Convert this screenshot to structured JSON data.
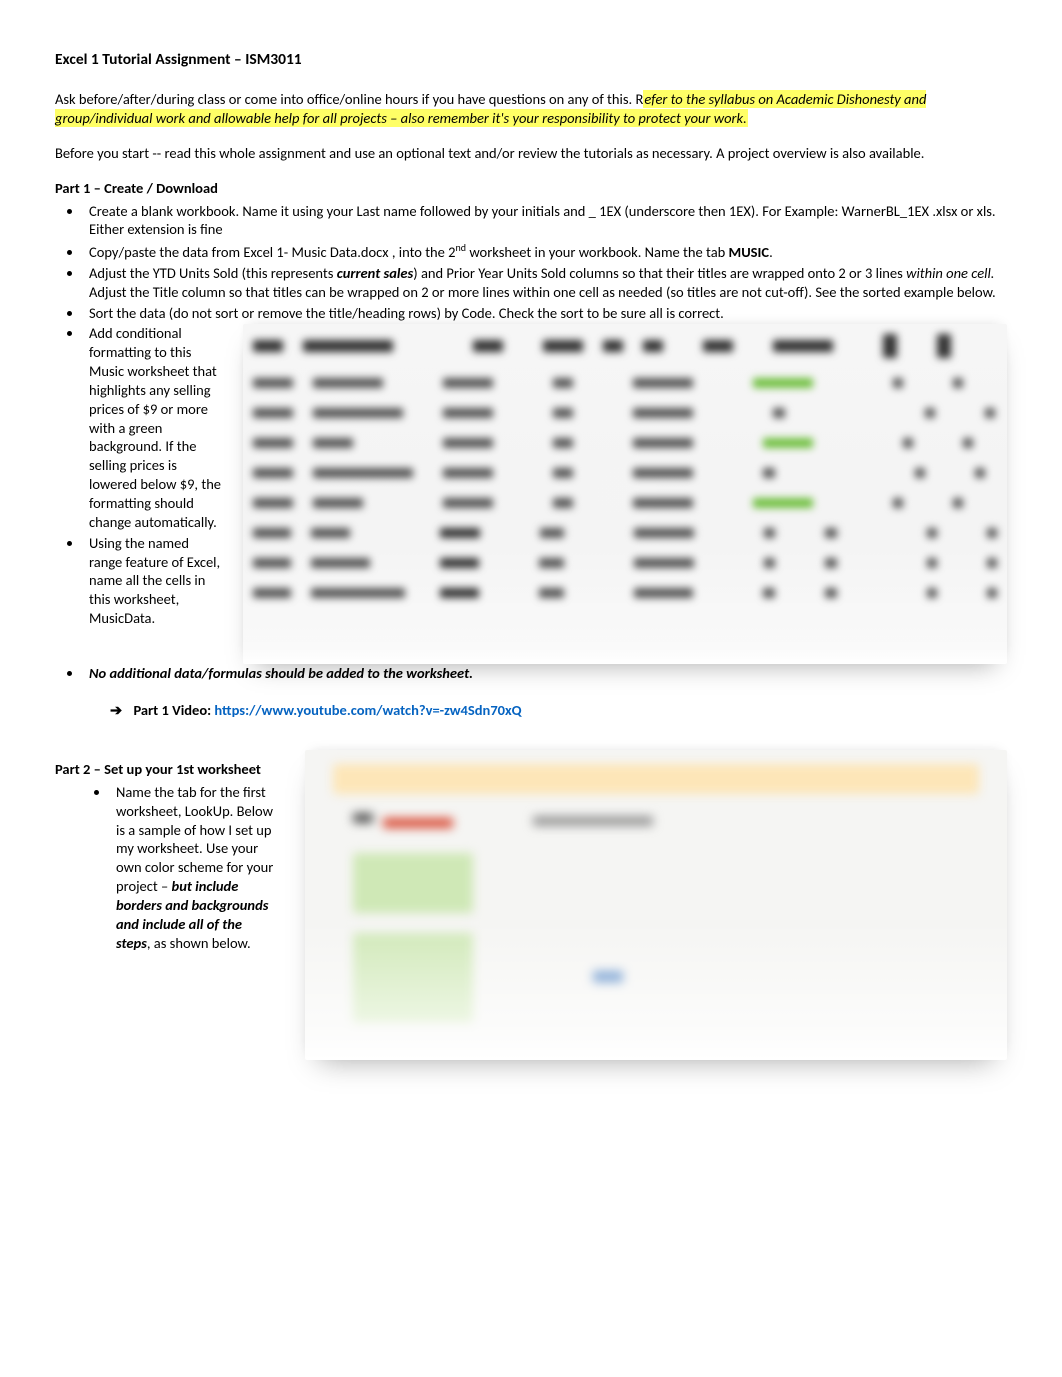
{
  "title": "Excel 1   Tutorial Assignment –  ISM3011",
  "intro": {
    "p1_a": "Ask before/after/during class or come into office/online hours if you have questions on any of this.  R",
    "p1_b_hi": "efer to the syllabus on Academic Dishonesty and group/individual work and allowable help for all projects – also remember it's your responsibility to protect your work.",
    "p2": "Before you start -- read this whole assignment and use an optional text and/or review the tutorials as necessary.   A project overview is also available."
  },
  "part1": {
    "heading": "Part 1 – Create / Download",
    "b1": "Create a blank workbook.  Name it using your Last name followed by your initials and _ 1EX (underscore then 1EX). For Example: WarnerBL_1EX .xlsx or xls.  Either extension is fine",
    "b2a": "Copy/paste the data from Excel 1- Music Data.docx , into the 2",
    "b2sup": "nd",
    "b2b": " worksheet in your workbook.  Name the tab ",
    "b2c_bold": "MUSIC",
    "b2d": ".",
    "b3a": "Adjust the YTD Units Sold (this represents ",
    "b3b_bi": "current sales",
    "b3c": ") and Prior Year Units Sold columns so that their titles are wrapped onto 2 or 3 lines ",
    "b3d_i": "within one cell.",
    "b3e": "  Adjust the Title column so that titles can be wrapped on 2 or more lines within one cell as needed (so titles are not cut-off).   See the sorted example below.",
    "b4": "Sort the data (do not sort or remove the title/heading rows) by Code.  Check the sort to be sure all is correct.",
    "b5": "Add conditional formatting to this Music worksheet that highlights any selling prices of $9 or more with a green background.  If the selling prices is lowered below $9, the formatting should change automatically.",
    "b6": "Using the named range feature of Excel, name all the cells in this worksheet, MusicData.",
    "b7_i": "No additional data/formulas should be added to the worksheet.",
    "video_label": "Part 1 Video:  ",
    "video_link": "https://www.youtube.com/watch?v=-zw4Sdn70xQ"
  },
  "part2": {
    "heading": "Part 2 – Set up your 1st worksheet",
    "b1a": "Name the tab for the first worksheet, LookUp.  Below is a sample of how I set up my worksheet.  Use your own color scheme for your project – ",
    "b1b_bi": "but include borders and backgrounds and include all of the steps",
    "b1c": ", as shown below."
  }
}
